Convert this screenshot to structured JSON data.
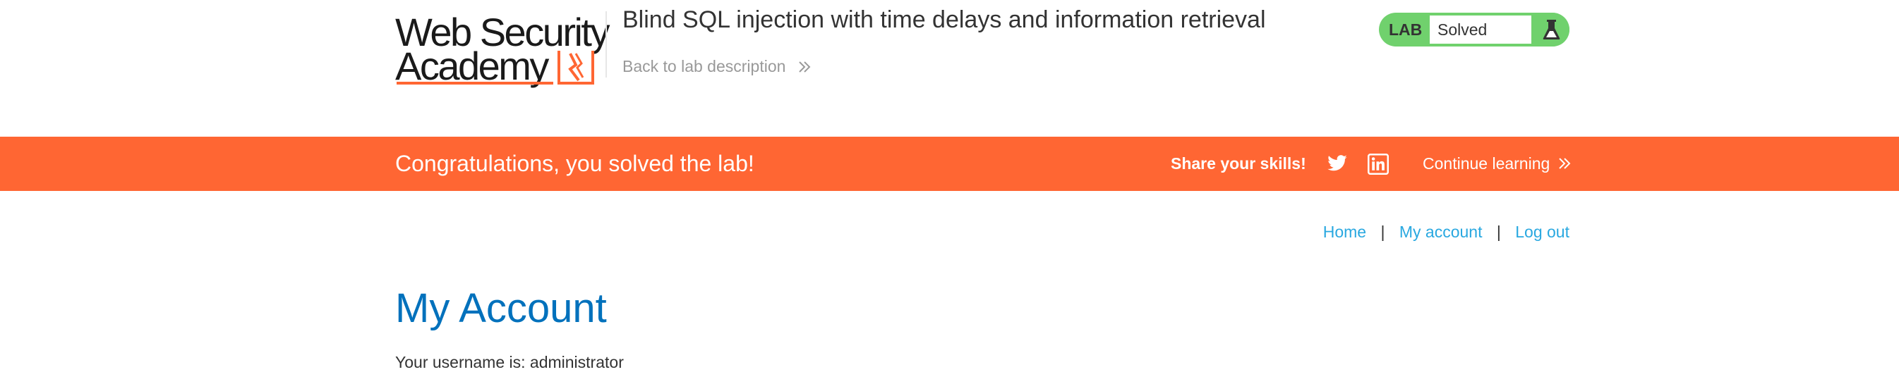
{
  "header": {
    "logo": {
      "line1": "Web Security",
      "line2": "Academy"
    },
    "lab_title": "Blind SQL injection with time delays and information retrieval",
    "back_link": "Back to lab description",
    "lab_badge": {
      "label": "LAB",
      "status": "Solved",
      "icon": "flask-icon"
    }
  },
  "banner": {
    "message": "Congratulations, you solved the lab!",
    "share_label": "Share your skills!",
    "social_icons": [
      "twitter-icon",
      "linkedin-icon"
    ],
    "continue_link": "Continue learning"
  },
  "nav": {
    "home": "Home",
    "separator": "|",
    "my_account": "My account",
    "log_out": "Log out"
  },
  "main": {
    "title": "My Account",
    "username_text": "Your username is: administrator"
  },
  "colors": {
    "brand_orange": "#ff6633",
    "solved_green": "#70d16d",
    "link_blue": "#29a8e0",
    "title_blue": "#0071bc",
    "text_dark": "#333333",
    "text_muted": "#999999"
  }
}
